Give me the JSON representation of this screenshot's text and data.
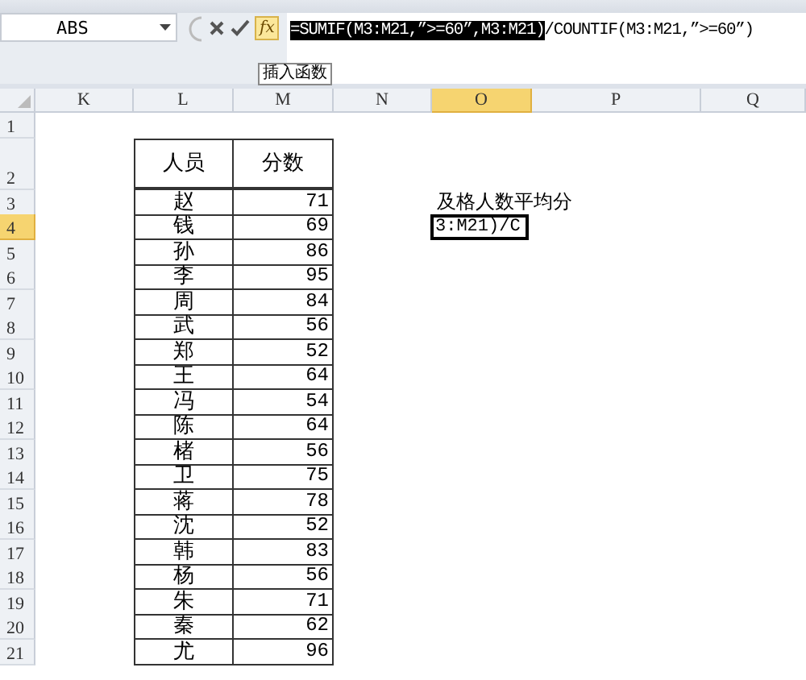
{
  "name_box": "ABS",
  "formula_bar": {
    "insert_function_label": "fx",
    "selected_text": "=SUMIF(M3:M21,”>=60”,M3:M21)",
    "rest_text": "/COUNTIF(M3:M21,”>=60”)"
  },
  "tooltip": "插入函数",
  "columns": [
    {
      "label": "K",
      "selected": false
    },
    {
      "label": "L",
      "selected": false
    },
    {
      "label": "M",
      "selected": false
    },
    {
      "label": "N",
      "selected": false
    },
    {
      "label": "O",
      "selected": true
    },
    {
      "label": "P",
      "selected": false
    },
    {
      "label": "Q",
      "selected": false
    }
  ],
  "rows": [
    {
      "number": "1",
      "selected": false
    },
    {
      "number": "2",
      "selected": false,
      "person": "人员",
      "score": "分数",
      "kind": "header"
    },
    {
      "number": "3",
      "selected": false,
      "person": "赵",
      "score": "71",
      "note": {
        "text": "及格人数平均分",
        "active": false
      }
    },
    {
      "number": "4",
      "selected": true,
      "person": "钱",
      "score": "69",
      "note": {
        "text": "3:M21)/C",
        "active": true
      }
    },
    {
      "number": "5",
      "selected": false,
      "person": "孙",
      "score": "86"
    },
    {
      "number": "6",
      "selected": false,
      "person": "李",
      "score": "95"
    },
    {
      "number": "7",
      "selected": false,
      "person": "周",
      "score": "84"
    },
    {
      "number": "8",
      "selected": false,
      "person": "武",
      "score": "56"
    },
    {
      "number": "9",
      "selected": false,
      "person": "郑",
      "score": "52"
    },
    {
      "number": "10",
      "selected": false,
      "person": "王",
      "score": "64"
    },
    {
      "number": "11",
      "selected": false,
      "person": "冯",
      "score": "54"
    },
    {
      "number": "12",
      "selected": false,
      "person": "陈",
      "score": "64"
    },
    {
      "number": "13",
      "selected": false,
      "person": "楮",
      "score": "56"
    },
    {
      "number": "14",
      "selected": false,
      "person": "卫",
      "score": "75"
    },
    {
      "number": "15",
      "selected": false,
      "person": "蒋",
      "score": "78"
    },
    {
      "number": "16",
      "selected": false,
      "person": "沈",
      "score": "52"
    },
    {
      "number": "17",
      "selected": false,
      "person": "韩",
      "score": "83"
    },
    {
      "number": "18",
      "selected": false,
      "person": "杨",
      "score": "56"
    },
    {
      "number": "19",
      "selected": false,
      "person": "朱",
      "score": "71"
    },
    {
      "number": "20",
      "selected": false,
      "person": "秦",
      "score": "62"
    },
    {
      "number": "21",
      "selected": false,
      "person": "尤",
      "score": "96"
    }
  ]
}
